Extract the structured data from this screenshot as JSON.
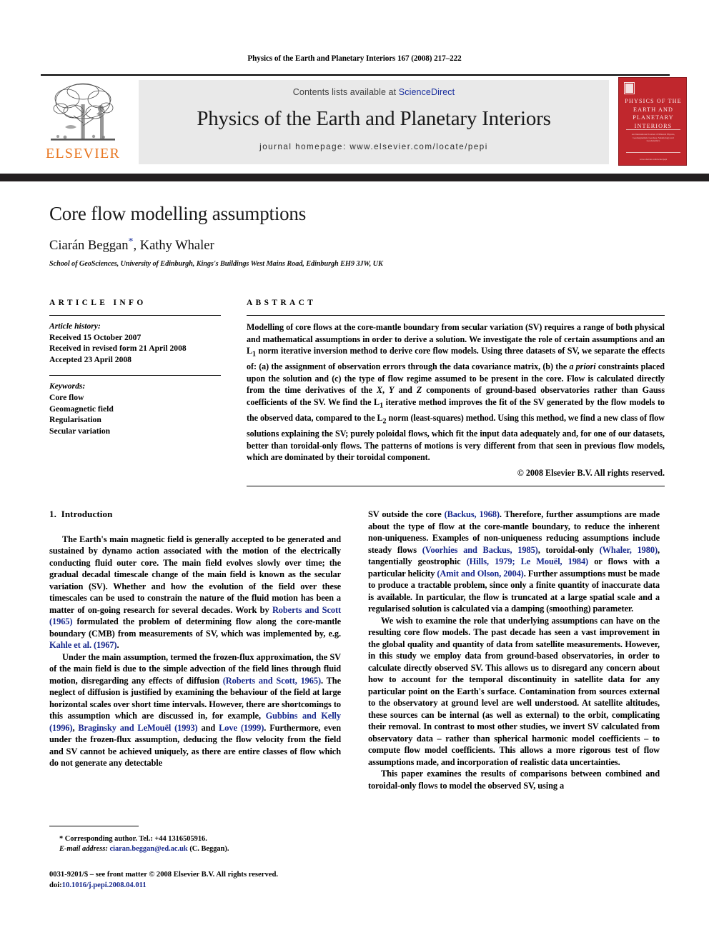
{
  "running_head": "Physics of the Earth and Planetary Interiors 167 (2008) 217–222",
  "masthead": {
    "publisher_name": "ELSEVIER",
    "contents_prefix": "Contents lists available at ",
    "contents_link": "ScienceDirect",
    "journal_title": "Physics of the Earth and Planetary Interiors",
    "homepage_line": "journal homepage: www.elsevier.com/locate/pepi"
  },
  "cover": {
    "title": "PHYSICS OF THE EARTH AND PLANETARY INTERIORS",
    "subtitle": "An International Journal of Mineral Physics, Geomagnetism, Geodesy, Seismology and Geodynamics",
    "footer": "www.elsevier.com/locate/pepi",
    "color": "#c0272d"
  },
  "article": {
    "title": "Core flow modelling assumptions",
    "authors": "Ciarán Beggan",
    "corresponding_marker": "*",
    "authors_rest": ", Kathy Whaler",
    "affiliation": "School of GeoSciences, University of Edinburgh, Kings's Buildings West Mains Road, Edinburgh EH9 3JW, UK"
  },
  "article_info": {
    "heading": "ARTICLE INFO",
    "history_label": "Article history:",
    "history": [
      "Received 15 October 2007",
      "Received in revised form 21 April 2008",
      "Accepted 23 April 2008"
    ],
    "keywords_label": "Keywords:",
    "keywords": [
      "Core flow",
      "Geomagnetic field",
      "Regularisation",
      "Secular variation"
    ]
  },
  "abstract": {
    "heading": "ABSTRACT",
    "text": "Modelling of core flows at the core-mantle boundary from secular variation (SV) requires a range of both physical and mathematical assumptions in order to derive a solution. We investigate the role of certain assumptions and an L1 norm iterative inversion method to derive core flow models. Using three datasets of SV, we separate the effects of: (a) the assignment of observation errors through the data covariance matrix, (b) the a priori constraints placed upon the solution and (c) the type of flow regime assumed to be present in the core. Flow is calculated directly from the time derivatives of the X, Y and Z components of ground-based observatories rather than Gauss coefficients of the SV. We find the L1 iterative method improves the fit of the SV generated by the flow models to the observed data, compared to the L2 norm (least-squares) method. Using this method, we find a new class of flow solutions explaining the SV; purely poloidal flows, which fit the input data adequately and, for one of our datasets, better than toroidal-only flows. The patterns of motions is very different from that seen in previous flow models, which are dominated by their toroidal component.",
    "copyright": "© 2008 Elsevier B.V. All rights reserved."
  },
  "body": {
    "section_number": "1.",
    "section_title": "Introduction",
    "left_paragraphs": [
      "The Earth's main magnetic field is generally accepted to be generated and sustained by dynamo action associated with the motion of the electrically conducting fluid outer core. The main field evolves slowly over time; the gradual decadal timescale change of the main field is known as the secular variation (SV). Whether and how the evolution of the field over these timescales can be used to constrain the nature of the fluid motion has been a matter of on-going research for several decades. Work by Roberts and Scott (1965) formulated the problem of determining flow along the core-mantle boundary (CMB) from measurements of SV, which was implemented by, e.g. Kahle et al. (1967).",
      "Under the main assumption, termed the frozen-flux approximation, the SV of the main field is due to the simple advection of the field lines through fluid motion, disregarding any effects of diffusion (Roberts and Scott, 1965). The neglect of diffusion is justified by examining the behaviour of the field at large horizontal scales over short time intervals. However, there are shortcomings to this assumption which are discussed in, for example, Gubbins and Kelly (1996), Braginsky and LeMouël (1993) and Love (1999). Furthermore, even under the frozen-flux assumption, deducing the flow velocity from the field and SV cannot be achieved uniquely, as there are entire classes of flow which do not generate any detectable"
    ],
    "right_paragraphs": [
      "SV outside the core (Backus, 1968). Therefore, further assumptions are made about the type of flow at the core-mantle boundary, to reduce the inherent non-uniqueness. Examples of non-uniqueness reducing assumptions include steady flows (Voorhies and Backus, 1985), toroidal-only (Whaler, 1980), tangentially geostrophic (Hills, 1979; Le Mouël, 1984) or flows with a particular helicity (Amit and Olson, 2004). Further assumptions must be made to produce a tractable problem, since only a finite quantity of inaccurate data is available. In particular, the flow is truncated at a large spatial scale and a regularised solution is calculated via a damping (smoothing) parameter.",
      "We wish to examine the role that underlying assumptions can have on the resulting core flow models. The past decade has seen a vast improvement in the global quality and quantity of data from satellite measurements. However, in this study we employ data from ground-based observatories, in order to calculate directly observed SV. This allows us to disregard any concern about how to account for the temporal discontinuity in satellite data for any particular point on the Earth's surface. Contamination from sources external to the observatory at ground level are well understood. At satellite altitudes, these sources can be internal (as well as external) to the orbit, complicating their removal. In contrast to most other studies, we invert SV calculated from observatory data – rather than spherical harmonic model coefficients – to compute flow model coefficients. This allows a more rigorous test of flow assumptions made, and incorporation of realistic data uncertainties.",
      "This paper examines the results of comparisons between combined and toroidal-only flows to model the observed SV, using a"
    ],
    "citation_color": "#17288c"
  },
  "footnote": {
    "corresponding": "* Corresponding author. Tel.: +44 1316505916.",
    "email_label": "E-mail address:",
    "email": "ciaran.beggan@ed.ac.uk",
    "email_suffix": "(C. Beggan)."
  },
  "footer": {
    "issn_line": "0031-9201/$ – see front matter © 2008 Elsevier B.V. All rights reserved.",
    "doi_label": "doi:",
    "doi": "10.1016/j.pepi.2008.04.011"
  }
}
